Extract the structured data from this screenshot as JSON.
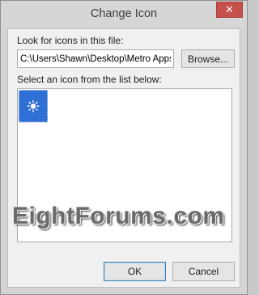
{
  "window": {
    "title": "Change Icon",
    "close_glyph": "✕"
  },
  "file_section": {
    "label": "Look for icons in this file:",
    "path_value": "C:\\Users\\Shawn\\Desktop\\Metro Apps",
    "browse_label": "Browse..."
  },
  "icon_section": {
    "label": "Select an icon from the list below:",
    "icons": [
      {
        "name": "sun-icon",
        "selected": true
      }
    ]
  },
  "watermark": {
    "text": "EightForums.com"
  },
  "buttons": {
    "ok_label": "OK",
    "cancel_label": "Cancel"
  },
  "colors": {
    "accent": "#2f6fd6",
    "close": "#c7504a"
  }
}
